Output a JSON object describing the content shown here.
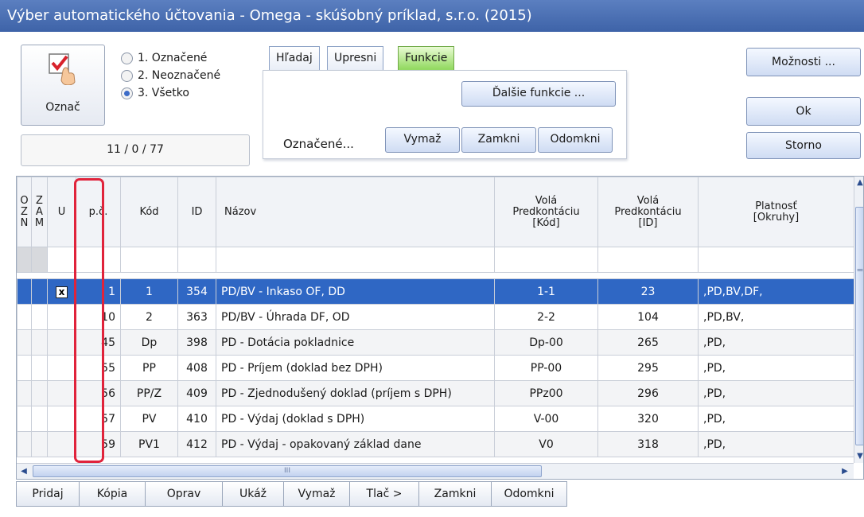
{
  "window": {
    "title": "Výber automatického účtovania - Omega - skúšobný príklad, s.r.o. (2015)"
  },
  "mark_button": {
    "label": "Označ",
    "icon": "checkmark-hand-icon"
  },
  "radios": [
    {
      "label": "1. Označené",
      "selected": false
    },
    {
      "label": "2. Neoznačené",
      "selected": false
    },
    {
      "label": "3. Všetko",
      "selected": true
    }
  ],
  "counter": "11 / 0 / 77",
  "tabs": {
    "items": [
      "Hľadaj",
      "Upresni",
      "Funkcie"
    ],
    "active": "Funkcie"
  },
  "panel": {
    "more_functions": "Ďalšie funkcie ...",
    "marked_label": "Označené...",
    "delete": "Vymaž",
    "lock": "Zamkni",
    "unlock": "Odomkni"
  },
  "right_buttons": {
    "options": "Možnosti ...",
    "ok": "Ok",
    "cancel": "Storno"
  },
  "grid": {
    "headers": {
      "ozn": [
        "O",
        "Z",
        "N"
      ],
      "zam": [
        "Z",
        "A",
        "M"
      ],
      "u": "U",
      "pc": "p.č.",
      "kod": "Kód",
      "id": "ID",
      "nazov": "Názov",
      "vola_kod": [
        "Volá",
        "Predkontáciu",
        "[Kód]"
      ],
      "vola_id": [
        "Volá",
        "Predkontáciu",
        "[ID]"
      ],
      "platnost": [
        "Platnosť",
        "[Okruhy]"
      ]
    },
    "rows": [
      {
        "u": "x",
        "pc": "1",
        "kod": "1",
        "id": "354",
        "nazov": "PD/BV - Inkaso OF, DD",
        "vola_kod": "1-1",
        "vola_id": "23",
        "platnost": ",PD,BV,DF,",
        "selected": true
      },
      {
        "u": "",
        "pc": "10",
        "kod": "2",
        "id": "363",
        "nazov": "PD/BV - Úhrada DF, OD",
        "vola_kod": "2-2",
        "vola_id": "104",
        "platnost": ",PD,BV,",
        "selected": false
      },
      {
        "u": "",
        "pc": "45",
        "kod": "Dp",
        "id": "398",
        "nazov": "PD - Dotácia pokladnice",
        "vola_kod": "Dp-00",
        "vola_id": "265",
        "platnost": ",PD,",
        "selected": false
      },
      {
        "u": "",
        "pc": "55",
        "kod": "PP",
        "id": "408",
        "nazov": "PD - Príjem (doklad bez DPH)",
        "vola_kod": "PP-00",
        "vola_id": "295",
        "platnost": ",PD,",
        "selected": false
      },
      {
        "u": "",
        "pc": "56",
        "kod": "PP/Z",
        "id": "409",
        "nazov": "PD - Zjednodušený doklad (príjem s DPH)",
        "vola_kod": "PPz00",
        "vola_id": "296",
        "platnost": ",PD,",
        "selected": false
      },
      {
        "u": "",
        "pc": "57",
        "kod": "PV",
        "id": "410",
        "nazov": "PD - Výdaj (doklad s DPH)",
        "vola_kod": "V-00",
        "vola_id": "320",
        "platnost": ",PD,",
        "selected": false
      },
      {
        "u": "",
        "pc": "59",
        "kod": "PV1",
        "id": "412",
        "nazov": "PD - Výdaj - opakovaný základ dane",
        "vola_kod": "V0",
        "vola_id": "318",
        "platnost": ",PD,",
        "selected": false
      }
    ]
  },
  "scrollbar": {
    "h_grip": "III",
    "v_grip": "="
  },
  "bottom_buttons": [
    "Pridaj",
    "Kópia",
    "Oprav",
    "Ukáž",
    "Vymaž",
    "Tlač >",
    "Zamkni",
    "Odomkni"
  ],
  "colors": {
    "title_bar": "#3e63a8",
    "selected_row": "#2f67c4",
    "active_tab": "#8fd85c",
    "highlight_box": "#e0233b"
  }
}
